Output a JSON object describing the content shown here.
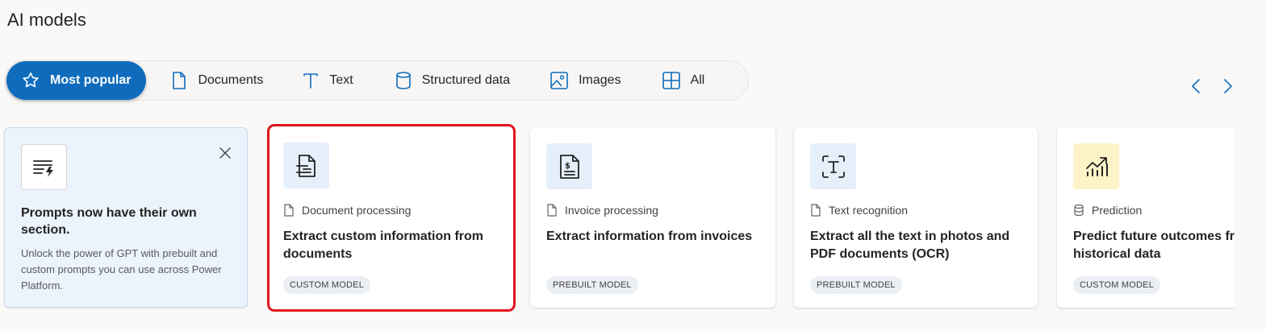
{
  "page": {
    "title": "AI models"
  },
  "filters": [
    {
      "label": "Most popular",
      "icon": "star-icon",
      "active": true
    },
    {
      "label": "Documents",
      "icon": "document-icon"
    },
    {
      "label": "Text",
      "icon": "text-icon"
    },
    {
      "label": "Structured data",
      "icon": "database-icon"
    },
    {
      "label": "Images",
      "icon": "image-icon"
    },
    {
      "label": "All",
      "icon": "grid-icon"
    }
  ],
  "promo": {
    "title": "Prompts now have their own section.",
    "description": "Unlock the power of GPT with prebuilt and custom prompts you can use across Power Platform.",
    "icon": "prompt-icon"
  },
  "cards": [
    {
      "category": "Document processing",
      "title": "Extract custom information from documents",
      "badge": "CUSTOM MODEL",
      "icon": "document-form-icon",
      "highlighted": true
    },
    {
      "category": "Invoice processing",
      "title": "Extract information from invoices",
      "badge": "PREBUILT MODEL",
      "icon": "invoice-icon"
    },
    {
      "category": "Text recognition",
      "title": "Extract all the text in photos and PDF documents (OCR)",
      "badge": "PREBUILT MODEL",
      "icon": "text-recognition-icon"
    },
    {
      "category": "Prediction",
      "title": "Predict future outcomes from historical data",
      "badge": "CUSTOM MODEL",
      "icon": "prediction-chart-icon"
    }
  ],
  "colors": {
    "accent": "#0f6cbd",
    "highlight": "#e3141f",
    "promo_bg": "#ebf3fc"
  }
}
